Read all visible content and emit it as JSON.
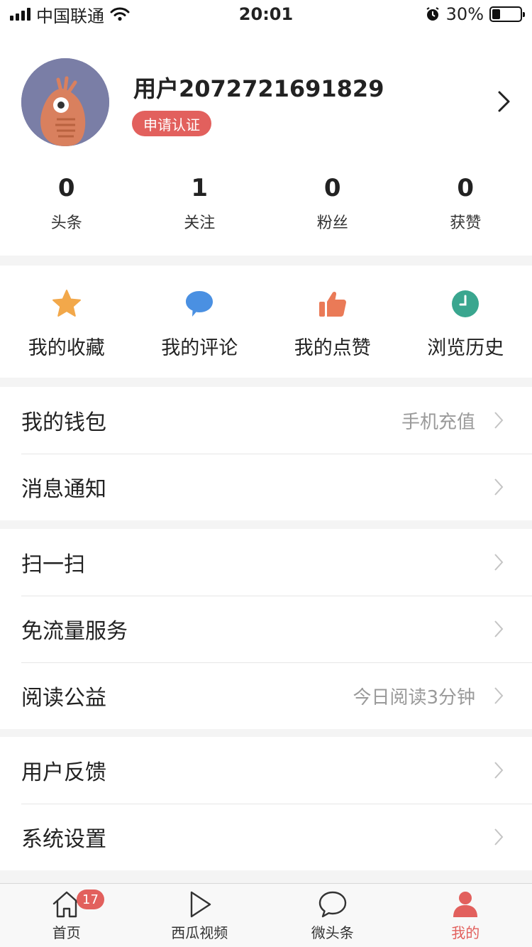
{
  "status_bar": {
    "carrier": "中国联通",
    "time": "20:01",
    "battery": "30%",
    "battery_level": 0.3
  },
  "profile": {
    "username": "用户2072721691829",
    "verify_label": "申请认证",
    "stats": [
      {
        "value": "0",
        "label": "头条"
      },
      {
        "value": "1",
        "label": "关注"
      },
      {
        "value": "0",
        "label": "粉丝"
      },
      {
        "value": "0",
        "label": "获赞"
      }
    ]
  },
  "quick_actions": [
    {
      "label": "我的收藏",
      "icon": "star-icon",
      "color": "#f2a84a"
    },
    {
      "label": "我的评论",
      "icon": "comment-icon",
      "color": "#4a90e2"
    },
    {
      "label": "我的点赞",
      "icon": "thumbs-up-icon",
      "color": "#ea7a57"
    },
    {
      "label": "浏览历史",
      "icon": "clock-icon",
      "color": "#3aa68f"
    }
  ],
  "menu_groups": [
    [
      {
        "label": "我的钱包",
        "hint": "手机充值"
      },
      {
        "label": "消息通知",
        "hint": ""
      }
    ],
    [
      {
        "label": "扫一扫",
        "hint": ""
      },
      {
        "label": "免流量服务",
        "hint": ""
      },
      {
        "label": "阅读公益",
        "hint": "今日阅读3分钟"
      }
    ],
    [
      {
        "label": "用户反馈",
        "hint": ""
      },
      {
        "label": "系统设置",
        "hint": ""
      }
    ]
  ],
  "tabbar": {
    "tabs": [
      {
        "label": "首页",
        "icon": "home-icon",
        "badge": "17"
      },
      {
        "label": "西瓜视频",
        "icon": "play-icon"
      },
      {
        "label": "微头条",
        "icon": "chat-bubble-icon"
      },
      {
        "label": "我的",
        "icon": "person-icon",
        "active": true
      }
    ]
  },
  "colors": {
    "accent": "#e2605d",
    "hint_text": "#9a9a9a"
  }
}
